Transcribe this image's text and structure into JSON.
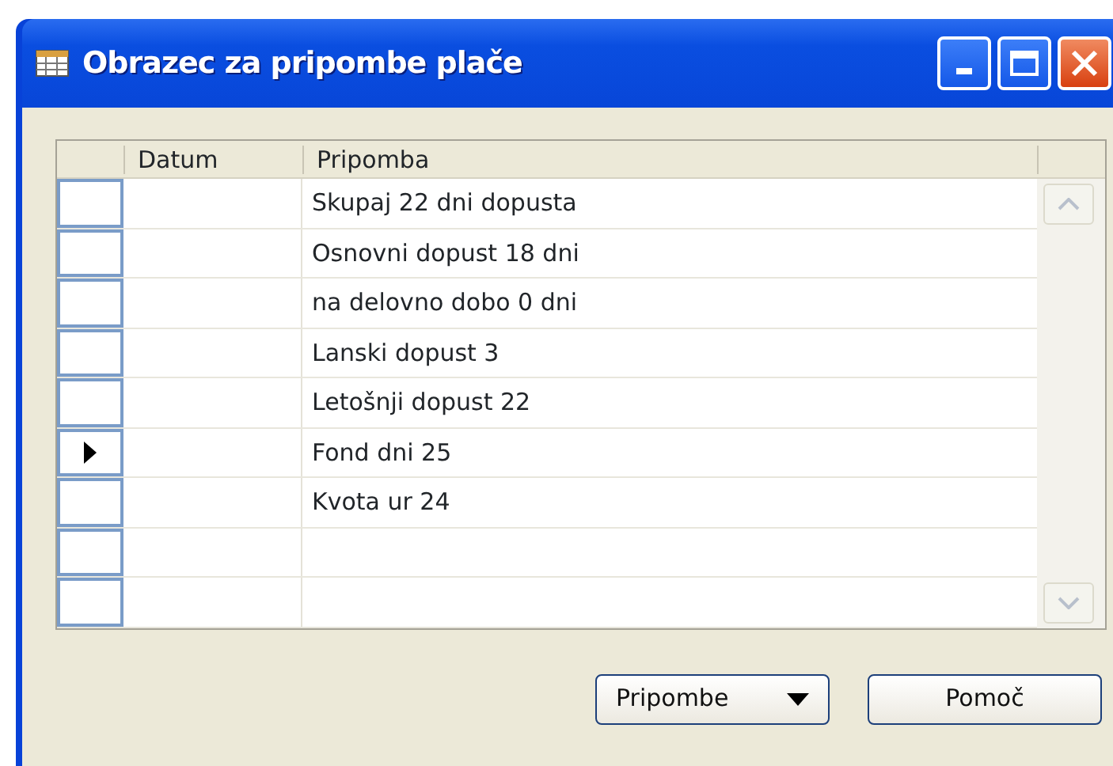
{
  "window": {
    "title": "Obrazec za pripombe plače"
  },
  "table": {
    "columns": [
      "Datum",
      "Pripomba"
    ],
    "rows": [
      {
        "pripomba": "Skupaj 22 dni dopusta",
        "selected": false
      },
      {
        "pripomba": "Osnovni dopust 18 dni",
        "selected": false
      },
      {
        "pripomba": "na delovno dobo 0 dni",
        "selected": false
      },
      {
        "pripomba": "Lanski dopust 3",
        "selected": false
      },
      {
        "pripomba": "Letošnji dopust 22",
        "selected": false
      },
      {
        "pripomba": "Fond dni 25",
        "selected": true
      },
      {
        "pripomba": "Kvota ur 24",
        "selected": false
      },
      {
        "selected": false
      },
      {
        "selected": false
      }
    ]
  },
  "buttons": [
    {
      "label": "Pripombe",
      "kind": "dropdown"
    },
    {
      "label": "Pomoč",
      "kind": "plain"
    }
  ]
}
